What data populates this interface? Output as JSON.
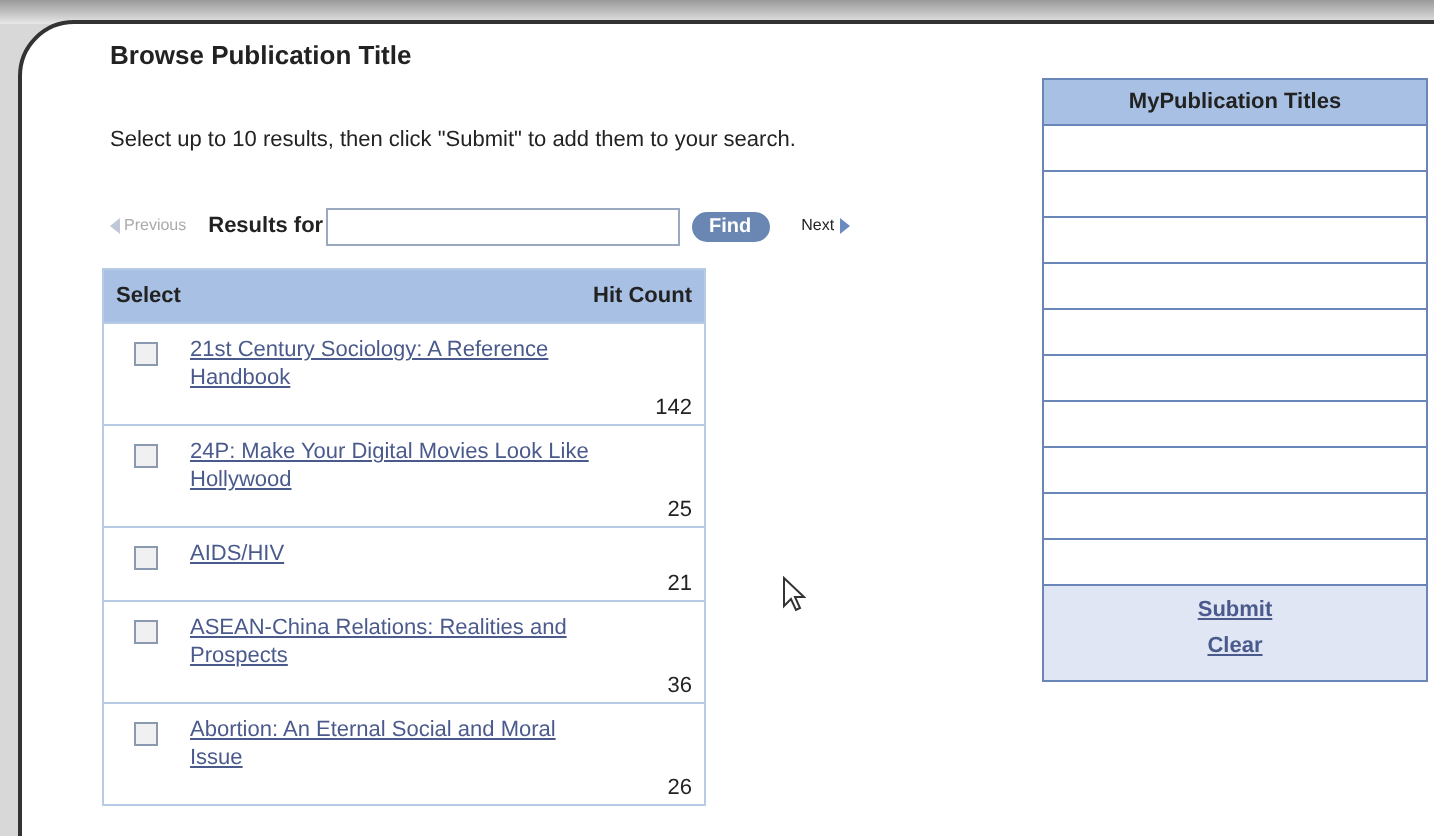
{
  "title": "Browse Publication Title",
  "instructions": "Select up to 10 results, then click \"Submit\" to add them to your search.",
  "search": {
    "previous": "Previous",
    "label": "Results for",
    "find": "Find",
    "next": "Next",
    "previous_disabled": true
  },
  "table": {
    "columns": [
      "Select",
      "Hit Count"
    ],
    "rows": [
      {
        "title": "21st Century Sociology: A Reference Handbook",
        "hits": "142",
        "checked": false
      },
      {
        "title": "24P: Make Your Digital Movies Look Like Hollywood",
        "hits": "25",
        "checked": false
      },
      {
        "title": "AIDS/HIV",
        "hits": "21",
        "checked": false
      },
      {
        "title": "ASEAN-China Relations: Realities and Prospects",
        "hits": "36",
        "checked": false
      },
      {
        "title": "Abortion: An Eternal Social and Moral Issue",
        "hits": "26",
        "checked": false
      }
    ]
  },
  "my_titles": {
    "heading": "MyPublication Titles",
    "actions": [
      "Submit",
      "Clear"
    ]
  }
}
